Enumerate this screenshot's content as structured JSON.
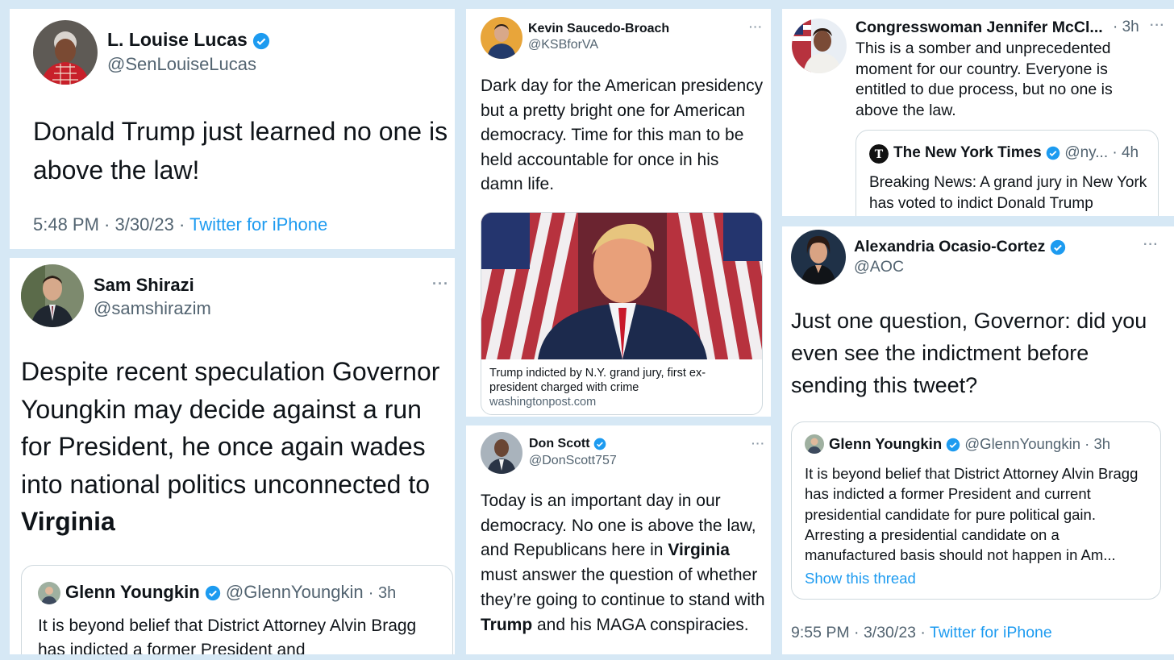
{
  "colors": {
    "background": "#d6e8f5",
    "verified": "#1d9bf0",
    "link": "#1d9bf0",
    "muted": "#536471"
  },
  "tweets": {
    "lucas": {
      "name": "L. Louise Lucas",
      "handle": "@SenLouiseLucas",
      "text": "Donald Trump just learned no one is above the law!",
      "time": "5:48 PM · 3/30/23 · ",
      "source": "Twitter for iPhone"
    },
    "shirazi": {
      "name": "Sam Shirazi",
      "handle": "@samshirazim",
      "text": "Despite recent speculation Governor Youngkin may decide against a run for President, he once again wades into national politics unconnected to",
      "text_bold": "Virginia",
      "quote": {
        "name": "Glenn Youngkin",
        "handle": "@GlennYoungkin",
        "age": "· 3h",
        "text": "It is beyond belief that District Attorney Alvin Bragg has indicted a former President and"
      }
    },
    "saucedo": {
      "name": "Kevin Saucedo-Broach",
      "handle": "@KSBforVA",
      "text": "Dark day for the American presidency but a pretty bright one for American democracy. Time for this man to be held accountable for once in his damn life.",
      "link_card": {
        "title": "Trump indicted by N.Y. grand jury, first ex-president charged with crime",
        "domain": "washingtonpost.com"
      }
    },
    "scott": {
      "name": "Don Scott",
      "handle": "@DonScott757",
      "text_1": "Today is an important day in our democracy. No one is above the law, and Republicans here in ",
      "bold_1": "Virginia",
      "text_2": " must answer the question of whether they’re going to continue to stand with ",
      "bold_2": "Trump",
      "text_3": " and his MAGA conspiracies."
    },
    "mcclellan": {
      "name": "Congresswoman Jennifer McCl...",
      "age": "· 3h",
      "text": "This is a somber and unprecedented moment for our country. Everyone is entitled to due process, but no one is above the law.",
      "quote": {
        "name": "The New York Times",
        "handle": "@ny...",
        "age": "· 4h",
        "text": "Breaking News: A grand jury in New York has voted to indict Donald Trump"
      }
    },
    "aoc": {
      "name": "Alexandria Ocasio-Cortez",
      "handle": "@AOC",
      "text": "Just one question, Governor: did you even see the indictment before sending this tweet?",
      "quote": {
        "name": "Glenn Youngkin",
        "handle": "@GlennYoungkin",
        "age": "· 3h",
        "text": "It is beyond belief that District Attorney Alvin Bragg has indicted a former President and current presidential candidate for pure political gain. Arresting a presidential candidate on a manufactured basis should not happen in Am...",
        "show_thread": "Show this thread"
      },
      "time": "9:55 PM · 3/30/23 · ",
      "source": "Twitter for iPhone"
    }
  },
  "menu_glyph": "···"
}
